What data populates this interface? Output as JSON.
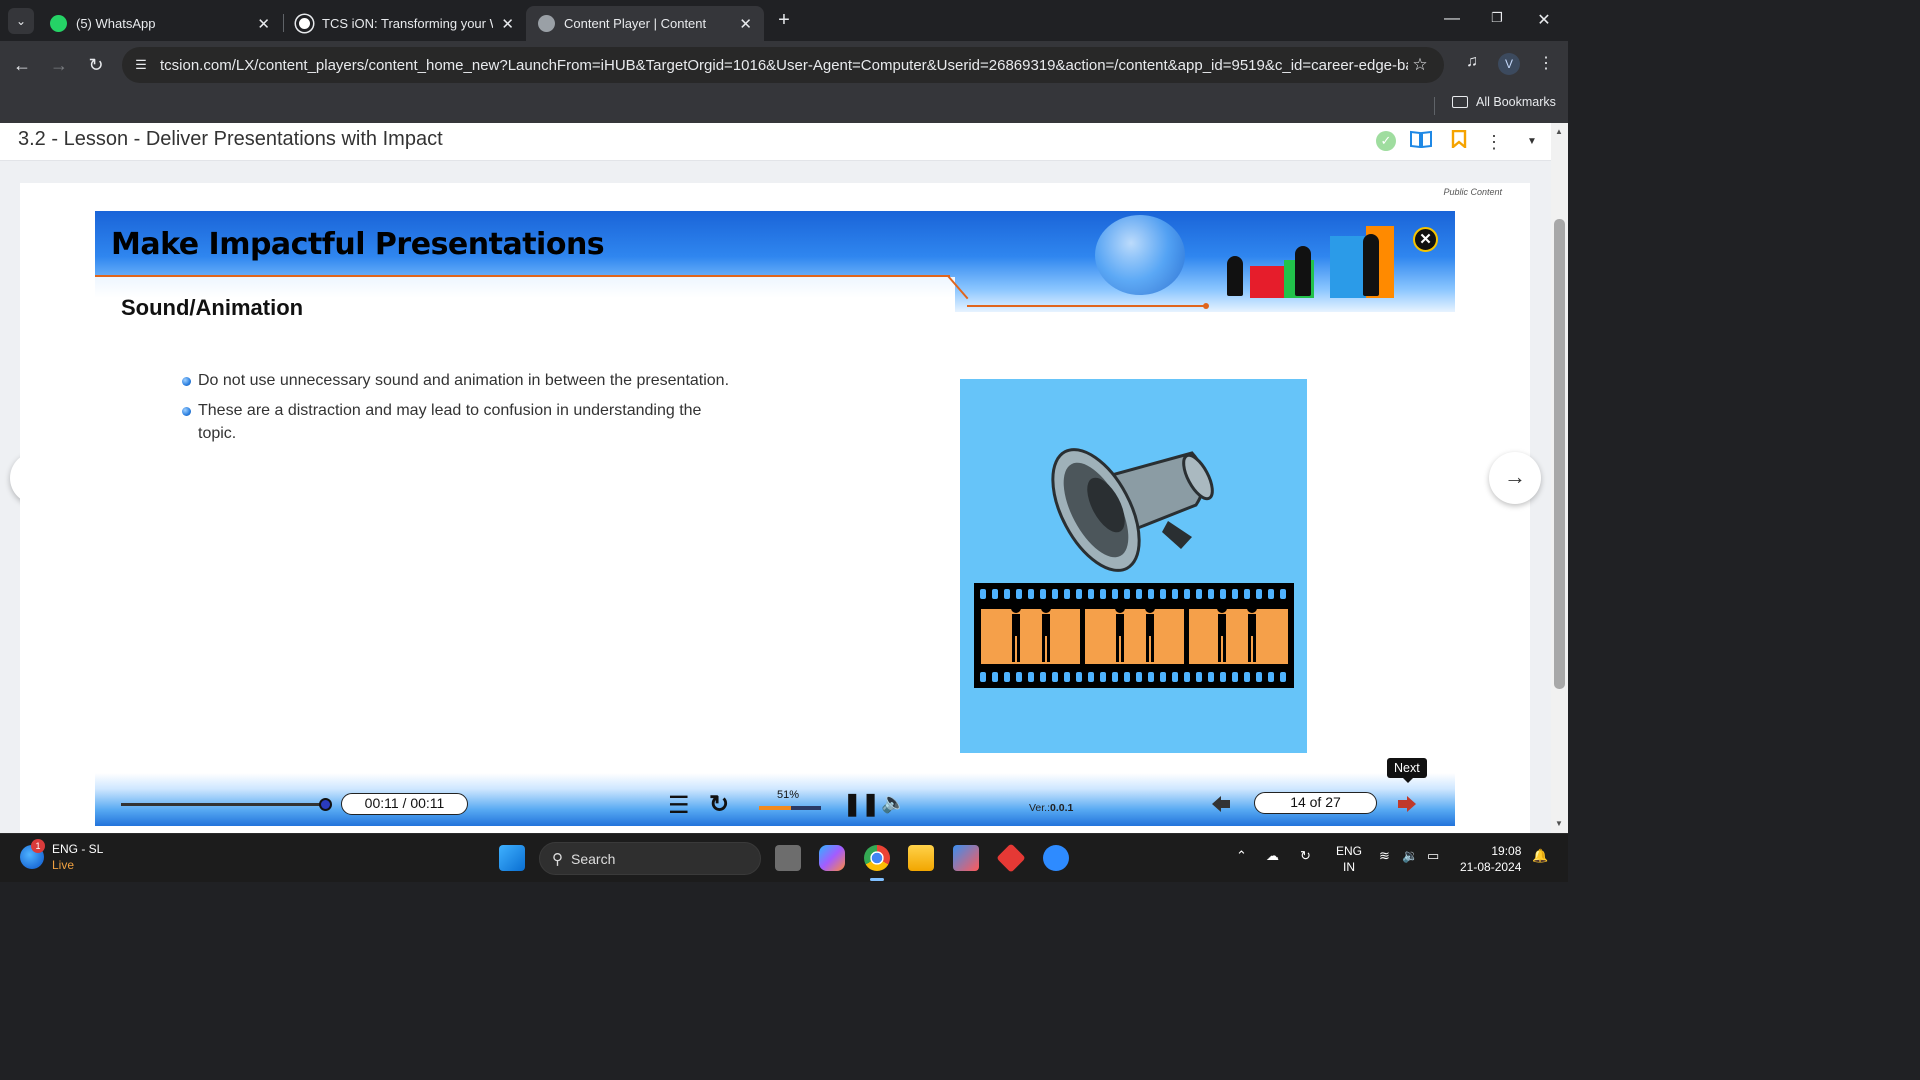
{
  "browser": {
    "tabs": [
      {
        "title": "(5) WhatsApp",
        "active": false
      },
      {
        "title": "TCS iON: Transforming your Wo",
        "active": false
      },
      {
        "title": "Content Player | Content",
        "active": true
      }
    ],
    "url": "tcsion.com/LX/content_players/content_home_new?LaunchFrom=iHUB&TargetOrgid=1016&User-Agent=Computer&Userid=26869319&action=/content&app_id=9519&c_id=career-edge-batch...",
    "profile_initial": "V",
    "all_bookmarks": "All Bookmarks"
  },
  "lesson": {
    "title": "3.2 - Lesson - Deliver Presentations with Impact",
    "public_label": "Public Content"
  },
  "slide": {
    "title": "Make Impactful Presentations",
    "subtitle": "Sound/Animation",
    "bullets": [
      "Do not use unnecessary sound and animation in between the presentation.",
      "These are a distraction and may lead to confusion in understanding the topic."
    ]
  },
  "player": {
    "time": "00:11 / 00:11",
    "progress_label": "51%",
    "progress_value": 0.51,
    "seek_value": 1.0,
    "version_label": "Ver.:",
    "version": "0.0.1",
    "page": "14 of 27",
    "next_tooltip": "Next"
  },
  "taskbar": {
    "weather_badge": "1",
    "weather_line1": "ENG - SL",
    "weather_line2": "Live",
    "search_label": "Search",
    "lang_line1": "ENG",
    "lang_line2": "IN",
    "time": "19:08",
    "date": "21-08-2024"
  },
  "colors": {
    "accent_orange": "#e0651c",
    "slide_blue": "#2f86ef",
    "illustration_bg": "#66c4f9",
    "bookmark_orange": "#f5a300",
    "check_green": "#9fdd9f"
  }
}
